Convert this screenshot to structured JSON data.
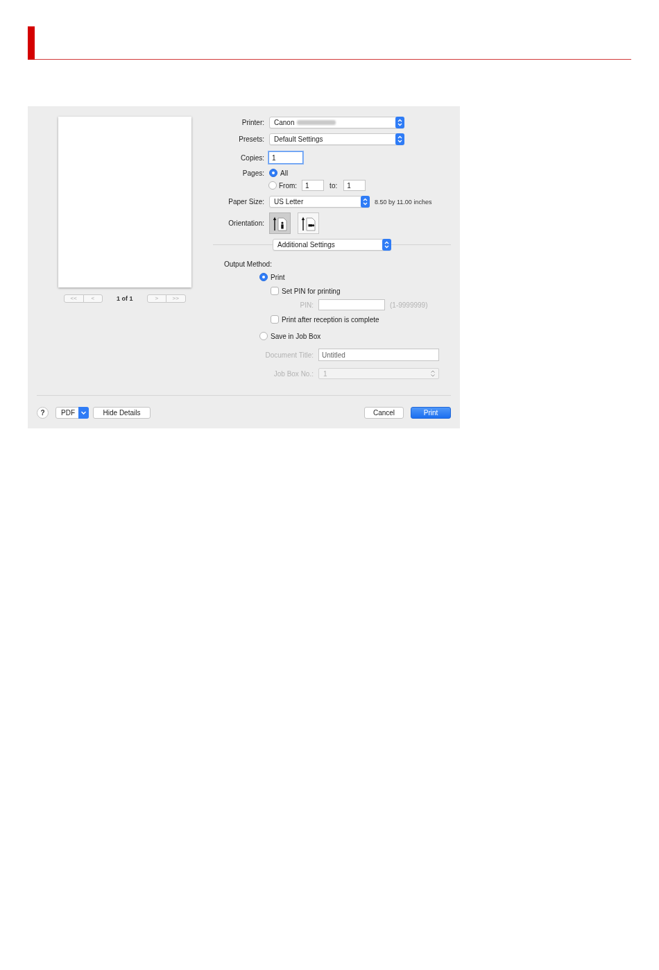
{
  "preview": {
    "page_label": "1 of 1",
    "nav": [
      {
        "label": "<<",
        "disabled": true
      },
      {
        "label": "<",
        "disabled": true
      },
      {
        "label": ">",
        "disabled": true
      },
      {
        "label": ">>",
        "disabled": true
      }
    ]
  },
  "printer": {
    "label": "Printer:",
    "value": "Canon",
    "redacted": true
  },
  "presets": {
    "label": "Presets:",
    "value": "Default Settings"
  },
  "copies": {
    "label": "Copies:",
    "value": "1",
    "focused": true
  },
  "pages": {
    "label": "Pages:",
    "options": [
      {
        "kind": "all",
        "label": "All",
        "selected": true
      },
      {
        "kind": "range",
        "label": "From:",
        "selected": false,
        "from": "1",
        "to_label": "to:",
        "to": "1"
      }
    ]
  },
  "paper_size": {
    "label": "Paper Size:",
    "value": "US Letter",
    "description": "8.50 by 11.00 inches"
  },
  "orientation": {
    "label": "Orientation:",
    "options": [
      {
        "kind": "portrait",
        "selected": true
      },
      {
        "kind": "landscape",
        "selected": false
      }
    ]
  },
  "panel_menu": {
    "value": "Additional Settings"
  },
  "output_method": {
    "label": "Output Method:",
    "options": [
      {
        "label": "Print",
        "selected": true,
        "settings": [
          {
            "kind": "checkbox",
            "label": "Set PIN for printing",
            "checked": false
          },
          {
            "kind": "text",
            "label": "PIN:",
            "disabled": true,
            "hint": "(1-9999999)"
          },
          {
            "kind": "checkbox",
            "label": "Print after reception is complete",
            "checked": false
          }
        ]
      },
      {
        "label": "Save in Job Box",
        "selected": false,
        "settings": [
          {
            "kind": "text",
            "label": "Document Title:",
            "disabled": true,
            "value": "Untitled"
          },
          {
            "kind": "select",
            "label": "Job Box No.:",
            "disabled": true,
            "value": "1"
          }
        ]
      }
    ]
  },
  "footer": {
    "help": "?",
    "pdf": "PDF",
    "hide_details": "Hide Details",
    "cancel": "Cancel",
    "print": "Print"
  }
}
